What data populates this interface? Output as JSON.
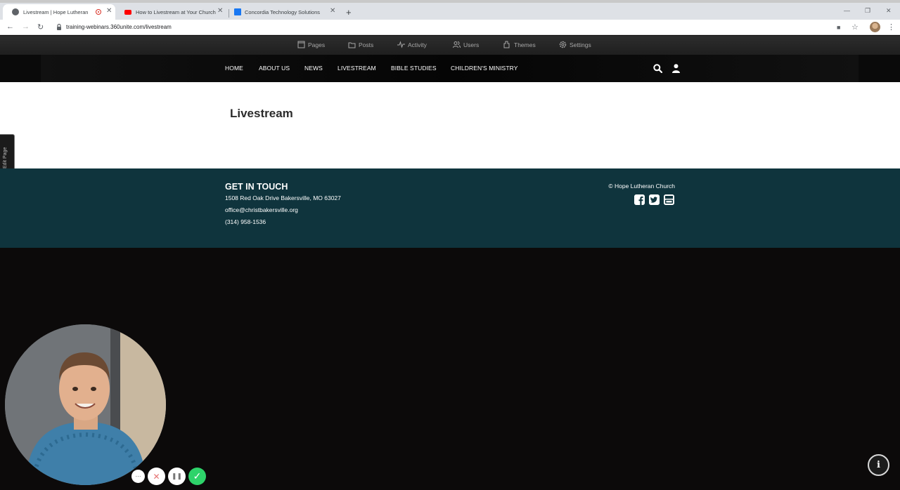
{
  "browser": {
    "tabs": [
      {
        "title": "Livestream | Hope Lutheran",
        "active": true,
        "recording": true
      },
      {
        "title": "How to Livestream at Your Church",
        "active": false
      },
      {
        "title": "Concordia Technology Solutions",
        "active": false
      }
    ],
    "url": "training-webinars.360unite.com/livestream",
    "new_tab_symbol": "+",
    "close_symbol": "✕"
  },
  "admin_toolbar": {
    "items": [
      {
        "label": "Pages",
        "icon": "pages-icon"
      },
      {
        "label": "Posts",
        "icon": "folder-icon"
      },
      {
        "label": "Activity",
        "icon": "activity-icon"
      },
      {
        "label": "Users",
        "icon": "users-icon"
      },
      {
        "label": "Themes",
        "icon": "paint-bucket-icon"
      },
      {
        "label": "Settings",
        "icon": "gear-icon"
      }
    ]
  },
  "site_nav": {
    "items": [
      "HOME",
      "ABOUT US",
      "NEWS",
      "LIVESTREAM",
      "BIBLE STUDIES",
      "CHILDREN'S MINISTRY"
    ]
  },
  "page": {
    "title": "Livestream",
    "edit_tab_label": "Edit Page"
  },
  "footer": {
    "heading": "GET IN TOUCH",
    "address": "1508 Red Oak Drive Bakersville, MO 63027",
    "email": "office@christbakersville.org",
    "phone": "(314) 958-1536",
    "copyright": "© Hope Lutheran Church",
    "social": [
      "facebook-icon",
      "twitter-icon",
      "youtube-icon"
    ],
    "colors": {
      "background": "#0f343d"
    }
  },
  "recorder": {
    "controls": [
      {
        "name": "more-options",
        "symbol": "···"
      },
      {
        "name": "cancel-recording",
        "symbol": "✕"
      },
      {
        "name": "pause-recording",
        "symbol": "❚❚"
      },
      {
        "name": "finish-recording",
        "symbol": "✓"
      }
    ],
    "info_symbol": "i"
  }
}
